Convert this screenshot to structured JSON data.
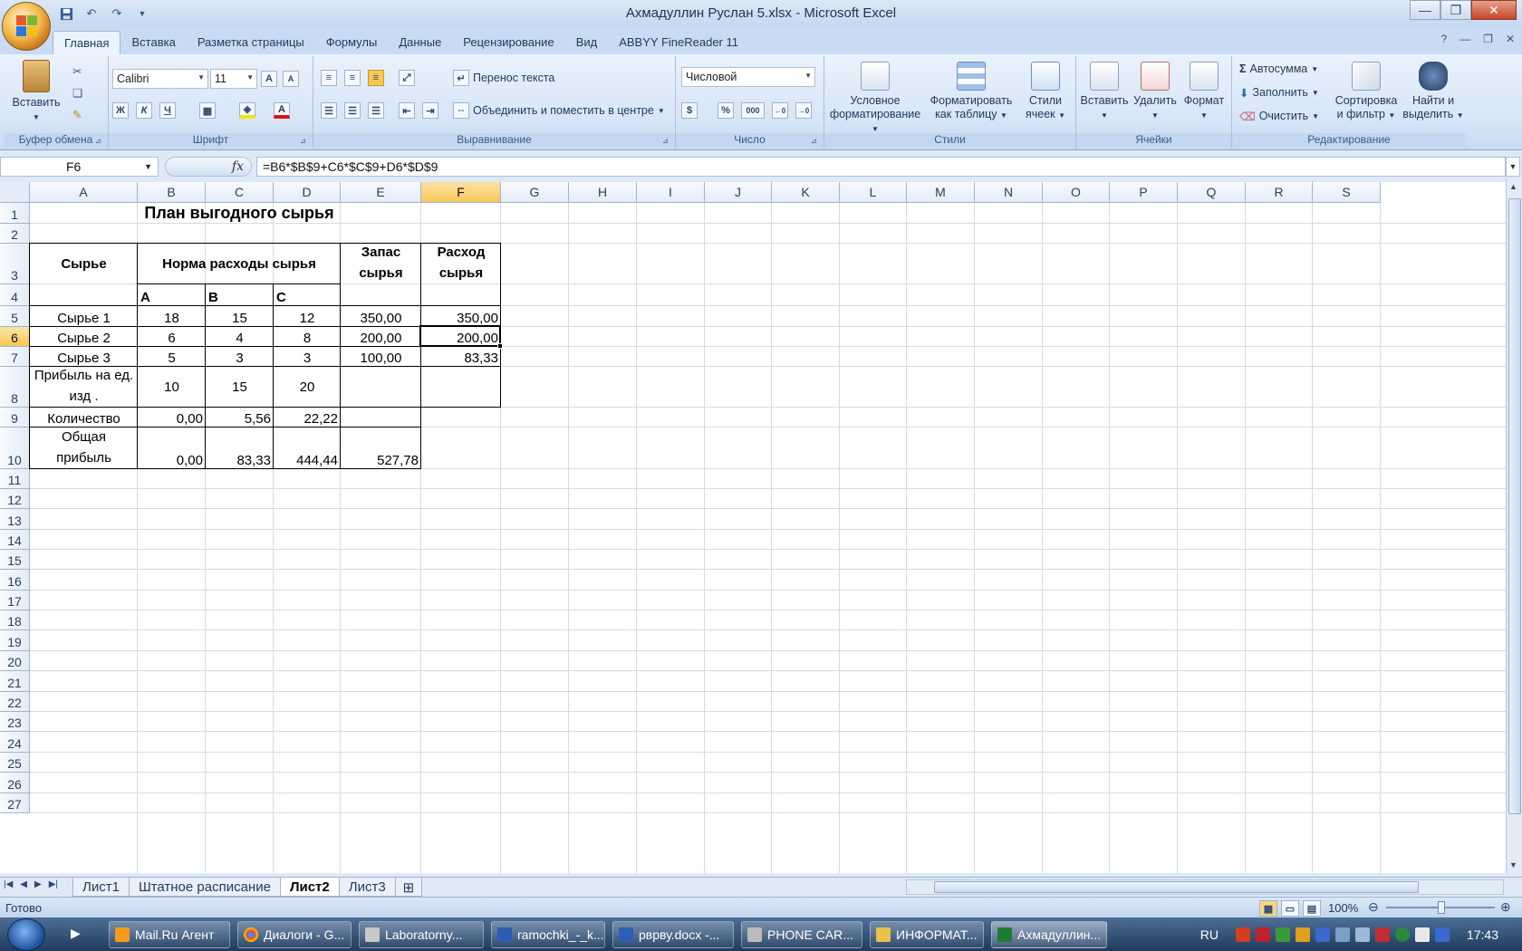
{
  "window": {
    "title": "Ахмадуллин Руслан 5.xlsx - Microsoft Excel",
    "qat_icons": [
      "save-icon",
      "undo-icon",
      "redo-icon",
      "customize-qat-icon"
    ]
  },
  "tabs": [
    "Главная",
    "Вставка",
    "Разметка страницы",
    "Формулы",
    "Данные",
    "Рецензирование",
    "Вид",
    "ABBYY FineReader 11"
  ],
  "active_tab": "Главная",
  "ribbon": {
    "clipboard": {
      "label": "Буфер обмена",
      "paste": "Вставить"
    },
    "font": {
      "label": "Шрифт",
      "name": "Calibri",
      "size": "11",
      "bold": "Ж",
      "italic": "К",
      "underline": "Ч"
    },
    "alignment": {
      "label": "Выравнивание",
      "wrap": "Перенос текста",
      "merge": "Объединить и поместить в центре"
    },
    "number": {
      "label": "Число",
      "format": "Числовой",
      "percent": "%",
      "thousands": "000"
    },
    "styles": {
      "label": "Стили",
      "conditional": [
        "Условное",
        "форматирование"
      ],
      "as_table": [
        "Форматировать",
        "как таблицу"
      ],
      "cell_styles": [
        "Стили",
        "ячеек"
      ]
    },
    "cells": {
      "label": "Ячейки",
      "insert": "Вставить",
      "delete": "Удалить",
      "format": "Формат"
    },
    "editing": {
      "label": "Редактирование",
      "autosum": "Автосумма",
      "fill": "Заполнить",
      "clear": "Очистить",
      "sort": [
        "Сортировка",
        "и фильтр"
      ],
      "find": [
        "Найти и",
        "выделить"
      ]
    }
  },
  "formula_bar": {
    "name_box": "F6",
    "fx": "fx",
    "formula": "=B6*$B$9+C6*$C$9+D6*$D$9"
  },
  "columns": [
    "A",
    "B",
    "C",
    "D",
    "E",
    "F",
    "G",
    "H",
    "I",
    "J",
    "K",
    "L",
    "M",
    "N",
    "O",
    "P",
    "Q",
    "R",
    "S"
  ],
  "rows": [
    "1",
    "2",
    "3",
    "4",
    "5",
    "6",
    "7",
    "8",
    "9",
    "10",
    "11",
    "12",
    "13",
    "14",
    "15",
    "16",
    "17",
    "18",
    "19",
    "20",
    "21",
    "22",
    "23",
    "24",
    "25",
    "26",
    "27"
  ],
  "selected": {
    "col": "F",
    "row": "6"
  },
  "sheet": {
    "title": "План выгодного сырья",
    "hdr_raw": "Сырье",
    "hdr_norm": "Норма расходы сырья",
    "hdr_stock": "Запас сырья",
    "hdr_usage": "Расход сырья",
    "sub_a": "A",
    "sub_b": "B",
    "sub_c": "C",
    "r5": [
      "Сырье 1",
      "18",
      "15",
      "12",
      "350,00",
      "350,00"
    ],
    "r6": [
      "Сырье 2",
      "6",
      "4",
      "8",
      "200,00",
      "200,00"
    ],
    "r7": [
      "Сырье 3",
      "5",
      "3",
      "3",
      "100,00",
      "83,33"
    ],
    "r8": [
      "Прибыль на ед. изд .",
      "10",
      "15",
      "20"
    ],
    "r9": [
      "Количество",
      "0,00",
      "5,56",
      "22,22"
    ],
    "r10": [
      "Общая прибыль",
      "0,00",
      "83,33",
      "444,44",
      "527,78"
    ]
  },
  "sheet_tabs": [
    "Лист1",
    "Штатное расписание",
    "Лист2",
    "Лист3"
  ],
  "active_sheet": "Лист2",
  "status": {
    "ready": "Готово",
    "zoom": "100%"
  },
  "taskbar": {
    "items": [
      "Mail.Ru Агент",
      "Диалоги - G...",
      "Laboratorny...",
      "ramochki_-_k...",
      "рврву.docx -...",
      "PHONE CAR...",
      "ИНФОРМАТ...",
      "Ахмадуллин..."
    ],
    "lang": "RU",
    "clock": "17:43"
  }
}
